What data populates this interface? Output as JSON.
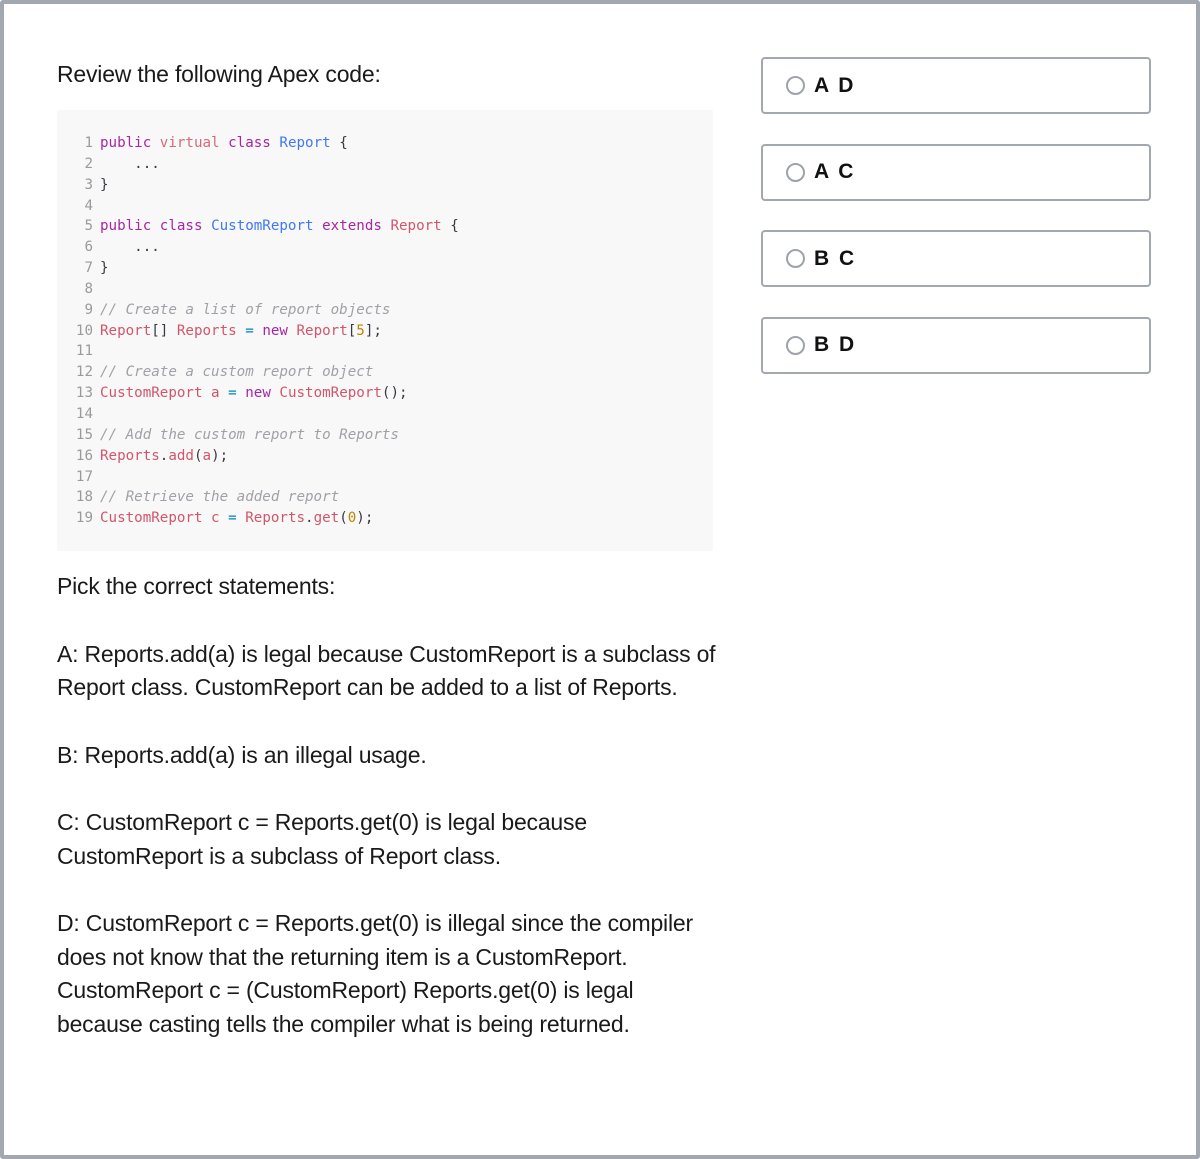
{
  "question": {
    "title": "Review the following Apex code:",
    "code_lines": [
      {
        "n": "1",
        "tokens": [
          {
            "t": "public",
            "c": "kw"
          },
          {
            "t": " ",
            "c": "pl"
          },
          {
            "t": "virtual",
            "c": "kw2"
          },
          {
            "t": " ",
            "c": "pl"
          },
          {
            "t": "class",
            "c": "kw"
          },
          {
            "t": " ",
            "c": "pl"
          },
          {
            "t": "Report",
            "c": "type"
          },
          {
            "t": " {",
            "c": "pl"
          }
        ]
      },
      {
        "n": "2",
        "tokens": [
          {
            "t": "    ...",
            "c": "pl"
          }
        ]
      },
      {
        "n": "3",
        "tokens": [
          {
            "t": "}",
            "c": "pl"
          }
        ]
      },
      {
        "n": "4",
        "tokens": []
      },
      {
        "n": "5",
        "tokens": [
          {
            "t": "public",
            "c": "kw"
          },
          {
            "t": " ",
            "c": "pl"
          },
          {
            "t": "class",
            "c": "kw"
          },
          {
            "t": " ",
            "c": "pl"
          },
          {
            "t": "CustomReport",
            "c": "type"
          },
          {
            "t": " ",
            "c": "pl"
          },
          {
            "t": "extends",
            "c": "kw"
          },
          {
            "t": " ",
            "c": "pl"
          },
          {
            "t": "Report",
            "c": "cls"
          },
          {
            "t": " {",
            "c": "pl"
          }
        ]
      },
      {
        "n": "6",
        "tokens": [
          {
            "t": "    ...",
            "c": "pl"
          }
        ]
      },
      {
        "n": "7",
        "tokens": [
          {
            "t": "}",
            "c": "pl"
          }
        ]
      },
      {
        "n": "8",
        "tokens": []
      },
      {
        "n": "9",
        "tokens": [
          {
            "t": "// Create a list of report objects",
            "c": "cm"
          }
        ]
      },
      {
        "n": "10",
        "tokens": [
          {
            "t": "Report",
            "c": "cls"
          },
          {
            "t": "[] ",
            "c": "pl"
          },
          {
            "t": "Reports",
            "c": "cls"
          },
          {
            "t": " ",
            "c": "pl"
          },
          {
            "t": "=",
            "c": "op"
          },
          {
            "t": " ",
            "c": "pl"
          },
          {
            "t": "new",
            "c": "kw"
          },
          {
            "t": " ",
            "c": "pl"
          },
          {
            "t": "Report",
            "c": "cls"
          },
          {
            "t": "[",
            "c": "pl"
          },
          {
            "t": "5",
            "c": "num"
          },
          {
            "t": "];",
            "c": "pl"
          }
        ]
      },
      {
        "n": "11",
        "tokens": []
      },
      {
        "n": "12",
        "tokens": [
          {
            "t": "// Create a custom report object",
            "c": "cm"
          }
        ]
      },
      {
        "n": "13",
        "tokens": [
          {
            "t": "CustomReport",
            "c": "cls"
          },
          {
            "t": " ",
            "c": "pl"
          },
          {
            "t": "a",
            "c": "cls"
          },
          {
            "t": " ",
            "c": "pl"
          },
          {
            "t": "=",
            "c": "op"
          },
          {
            "t": " ",
            "c": "pl"
          },
          {
            "t": "new",
            "c": "kw"
          },
          {
            "t": " ",
            "c": "pl"
          },
          {
            "t": "CustomReport",
            "c": "cls"
          },
          {
            "t": "();",
            "c": "pl"
          }
        ]
      },
      {
        "n": "14",
        "tokens": []
      },
      {
        "n": "15",
        "tokens": [
          {
            "t": "// Add the custom report to Reports",
            "c": "cm"
          }
        ]
      },
      {
        "n": "16",
        "tokens": [
          {
            "t": "Reports",
            "c": "cls"
          },
          {
            "t": ".",
            "c": "pl"
          },
          {
            "t": "add",
            "c": "fn"
          },
          {
            "t": "(",
            "c": "pl"
          },
          {
            "t": "a",
            "c": "cls"
          },
          {
            "t": ");",
            "c": "pl"
          }
        ]
      },
      {
        "n": "17",
        "tokens": []
      },
      {
        "n": "18",
        "tokens": [
          {
            "t": "// Retrieve the added report",
            "c": "cm"
          }
        ]
      },
      {
        "n": "19",
        "tokens": [
          {
            "t": "CustomReport",
            "c": "cls"
          },
          {
            "t": " ",
            "c": "pl"
          },
          {
            "t": "c",
            "c": "cls"
          },
          {
            "t": " ",
            "c": "pl"
          },
          {
            "t": "=",
            "c": "op"
          },
          {
            "t": " ",
            "c": "pl"
          },
          {
            "t": "Reports",
            "c": "cls"
          },
          {
            "t": ".",
            "c": "pl"
          },
          {
            "t": "get",
            "c": "fn"
          },
          {
            "t": "(",
            "c": "pl"
          },
          {
            "t": "0",
            "c": "num"
          },
          {
            "t": ");",
            "c": "pl"
          }
        ]
      }
    ],
    "prompt": "Pick the correct statements:",
    "statements": [
      "A: Reports.add(a) is legal because CustomReport is a subclass of Report class. CustomReport can be added to a list of Reports.",
      "B: Reports.add(a) is an illegal usage.",
      "C: CustomReport c = Reports.get(0) is legal because CustomReport is a subclass of Report class.",
      "D: CustomReport c = Reports.get(0) is illegal since the compiler does not know that the returning item is a CustomReport. CustomReport c = (CustomReport) Reports.get(0) is legal because casting tells the compiler what is being returned."
    ]
  },
  "options": [
    {
      "label": "A D",
      "icon": "radio-unchecked-icon",
      "selected": false
    },
    {
      "label": "A C",
      "icon": "radio-unchecked-icon",
      "selected": false
    },
    {
      "label": "B C",
      "icon": "radio-unchecked-icon",
      "selected": false
    },
    {
      "label": "B D",
      "icon": "radio-unchecked-icon",
      "selected": false
    }
  ]
}
